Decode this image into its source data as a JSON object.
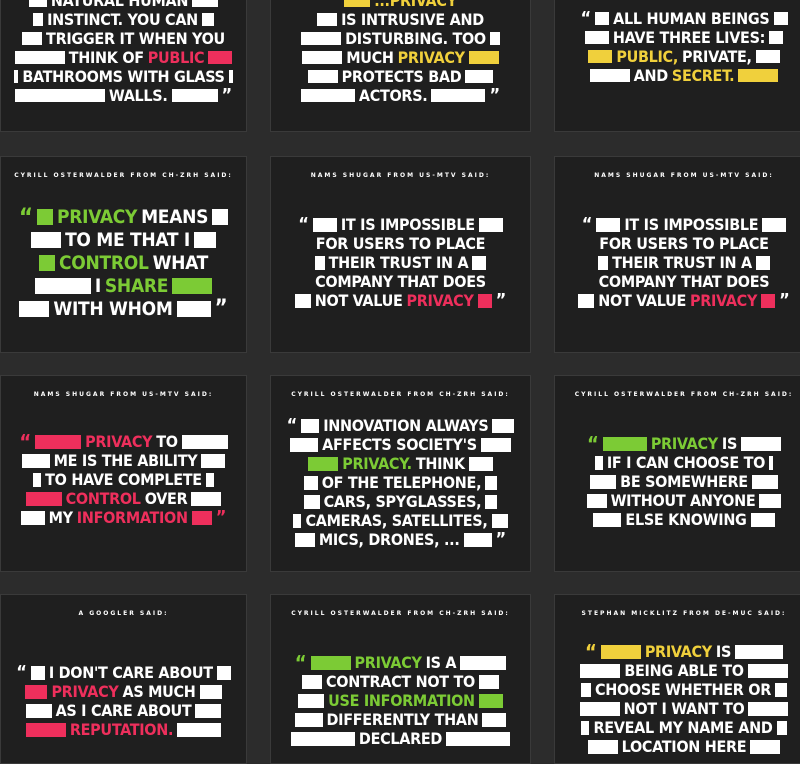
{
  "colors": {
    "pink": "#ee2f5c",
    "green": "#7ccb35",
    "yellow": "#f0d03c",
    "card": "#1f1f1f",
    "page": "#2c2c2c"
  },
  "open_quote": "“",
  "close_quote": "”",
  "cards": [
    {
      "id": "c1",
      "attribution": "",
      "lines": [
        [
          "natural human"
        ],
        [
          "instinct. You can"
        ],
        [
          "trigger it when you"
        ],
        [
          "think of ",
          "public"
        ],
        [
          "bathrooms with glass"
        ],
        [
          "walls."
        ]
      ]
    },
    {
      "id": "c2",
      "attribution": "",
      "lines": [
        [
          "...privacy"
        ],
        [
          "is intrusive and"
        ],
        [
          "disturbing. Too"
        ],
        [
          "much ",
          "privacy"
        ],
        [
          "protects bad"
        ],
        [
          "actors."
        ]
      ]
    },
    {
      "id": "c3",
      "attribution": "",
      "lines": [
        [
          "All human beings"
        ],
        [
          "have three lives:"
        ],
        [
          "public,",
          " private,"
        ],
        [
          "and ",
          "secret."
        ]
      ]
    },
    {
      "id": "c4",
      "attribution": "Cyrill Osterwalder from CH-ZRH said:",
      "lines": [
        [
          "privacy",
          " means"
        ],
        [
          "to me that I"
        ],
        [
          "control",
          " what"
        ],
        [
          "I ",
          "share"
        ],
        [
          "with whom"
        ]
      ]
    },
    {
      "id": "c5",
      "attribution": "Nams Shugar from US-MTV said:",
      "lines": [
        [
          "It is impossible"
        ],
        [
          "for users to place"
        ],
        [
          "their trust in a"
        ],
        [
          "company that does"
        ],
        [
          "not value ",
          "privacy"
        ]
      ]
    },
    {
      "id": "c6",
      "attribution": "Nams Shugar from US-MTV said:",
      "lines": [
        [
          "It is impossible"
        ],
        [
          "for users to place"
        ],
        [
          "their trust in a"
        ],
        [
          "company that does"
        ],
        [
          "not value ",
          "privacy"
        ]
      ]
    },
    {
      "id": "c7",
      "attribution": "Nams Shugar from US-MTV said:",
      "lines": [
        [
          "privacy",
          " to"
        ],
        [
          "me is the ability"
        ],
        [
          "to have complete"
        ],
        [
          "control",
          " over"
        ],
        [
          "my ",
          "information"
        ]
      ]
    },
    {
      "id": "c8",
      "attribution": "Cyrill Osterwalder from CH-ZRH said:",
      "lines": [
        [
          "Innovation always"
        ],
        [
          "affects society's"
        ],
        [
          "privacy.",
          " Think"
        ],
        [
          "of the telephone,"
        ],
        [
          "cars, spyglasses,"
        ],
        [
          "cameras, satellites,"
        ],
        [
          "mics, drones, ..."
        ]
      ]
    },
    {
      "id": "c9",
      "attribution": "Cyrill Osterwalder from CH-ZRH said:",
      "lines": [
        [
          "privacy",
          " is"
        ],
        [
          "if I can choose to"
        ],
        [
          "be somewhere"
        ],
        [
          "without anyone"
        ],
        [
          "else knowing"
        ]
      ]
    },
    {
      "id": "c10",
      "attribution": "A Googler said:",
      "lines": [
        [
          "I don't care about"
        ],
        [
          "privacy",
          " as much"
        ],
        [
          "as I care about"
        ],
        [
          "reputation."
        ]
      ]
    },
    {
      "id": "c11",
      "attribution": "Cyrill Osterwalder from CH-ZRH said:",
      "lines": [
        [
          "privacy",
          " is a"
        ],
        [
          "contract not to"
        ],
        [
          "use information"
        ],
        [
          "differently than"
        ],
        [
          "declared"
        ]
      ]
    },
    {
      "id": "c12",
      "attribution": "Stephan Micklitz from DE-MUC said:",
      "lines": [
        [
          "privacy",
          " is"
        ],
        [
          "being able to"
        ],
        [
          "choose whether or"
        ],
        [
          "not I want to"
        ],
        [
          "reveal my name and"
        ],
        [
          "location here"
        ]
      ]
    }
  ]
}
